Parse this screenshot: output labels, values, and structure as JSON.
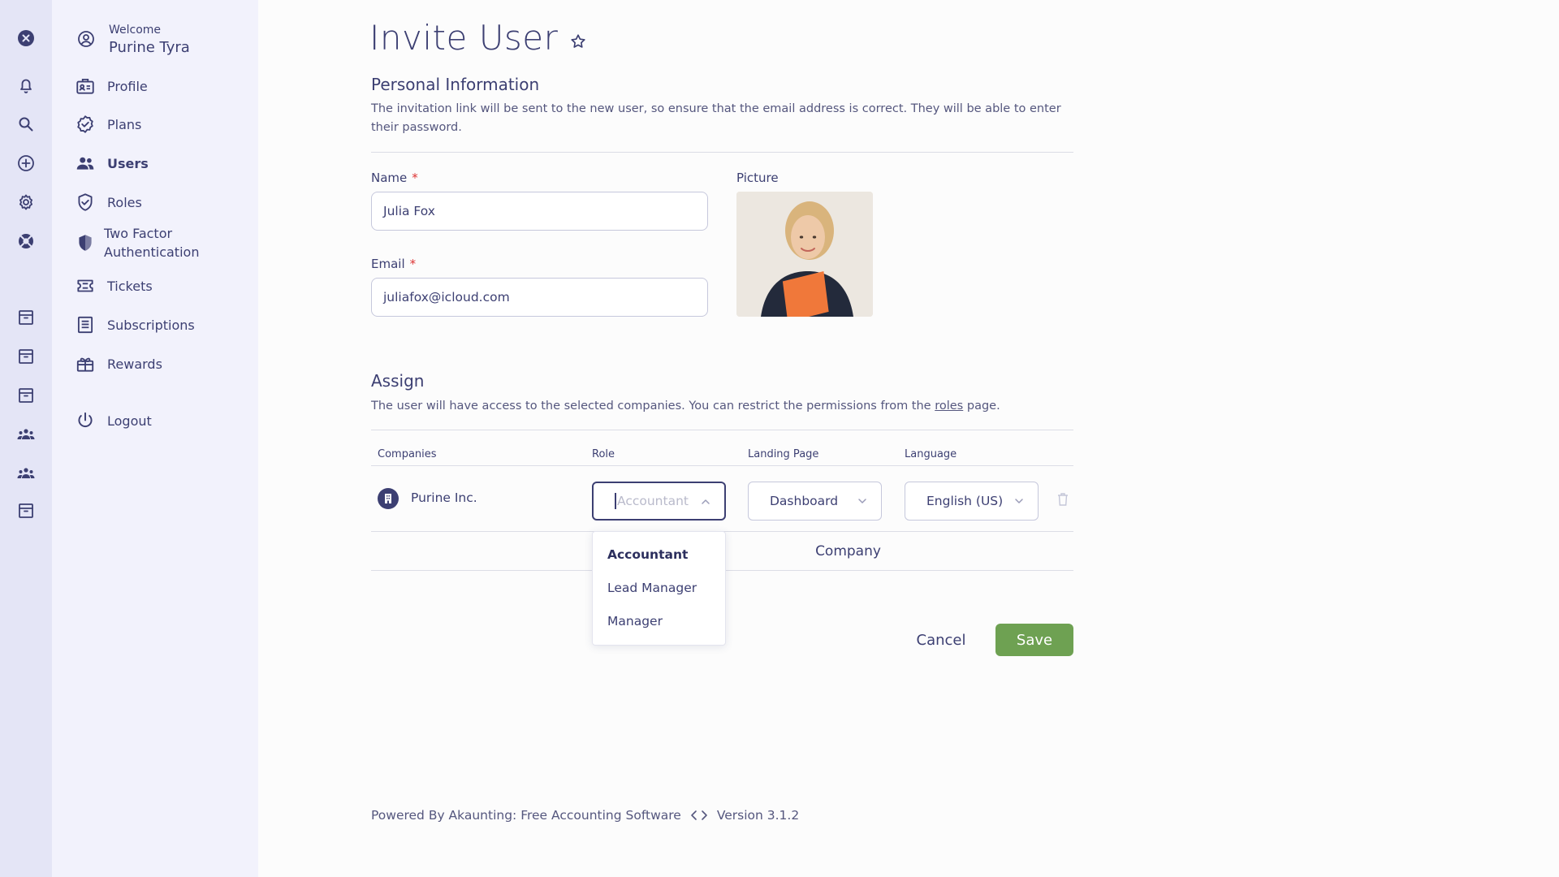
{
  "user": {
    "welcome": "Welcome",
    "name": "Purine Tyra"
  },
  "sidebar": {
    "items": [
      {
        "label": "Profile"
      },
      {
        "label": "Plans"
      },
      {
        "label": "Users"
      },
      {
        "label": "Roles"
      },
      {
        "label": "Two Factor Authentication"
      },
      {
        "label": "Tickets"
      },
      {
        "label": "Subscriptions"
      },
      {
        "label": "Rewards"
      },
      {
        "label": "Logout"
      }
    ]
  },
  "page": {
    "title": "Invite User"
  },
  "personal": {
    "title": "Personal Information",
    "description": "The invitation link will be sent to the new user, so ensure that the email address is correct. They will be able to enter their password.",
    "name_label": "Name",
    "name_value": "Julia Fox",
    "email_label": "Email",
    "email_value": "juliafox@icloud.com",
    "picture_label": "Picture",
    "required_mark": "*"
  },
  "assign": {
    "title": "Assign",
    "description_before": "The user will have access to the selected companies. You can restrict the permissions from the ",
    "description_link": "roles",
    "description_after": " page.",
    "columns": [
      "Companies",
      "Role",
      "Landing Page",
      "Language"
    ],
    "row": {
      "company": "Purine Inc.",
      "role_placeholder": "Accountant",
      "landing_page": "Dashboard",
      "language": "English (US)"
    },
    "add_company_partial": "Company",
    "role_options": [
      "Accountant",
      "Lead Manager",
      "Manager"
    ]
  },
  "actions": {
    "cancel": "Cancel",
    "save": "Save"
  },
  "footer": {
    "powered_by": "Powered By Akaunting: Free Accounting Software",
    "version": "Version 3.1.2"
  },
  "colors": {
    "primary": "#3c3f72",
    "save": "#6ea152",
    "rail_bg": "#e4e5f6",
    "menu_bg": "#f2f2fc"
  }
}
